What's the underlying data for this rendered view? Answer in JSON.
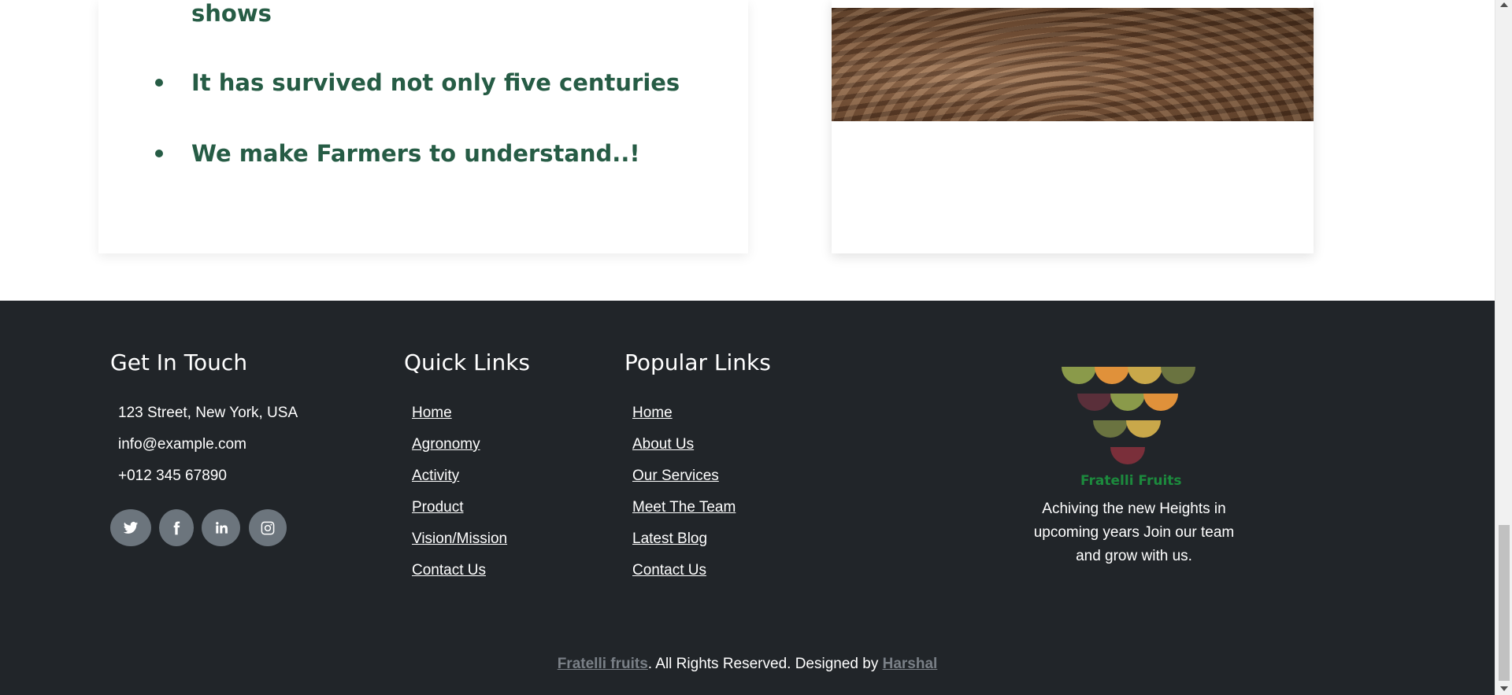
{
  "features": {
    "continued_text": "shows",
    "items": [
      "It has survived not only five centuries",
      "We make Farmers to understand..!"
    ]
  },
  "footer": {
    "get_in_touch": {
      "title": "Get In Touch",
      "address": "123 Street, New York, USA",
      "email": "info@example.com",
      "phone": "+012 345 67890",
      "social": [
        "twitter-icon",
        "facebook-icon",
        "linkedin-icon",
        "instagram-icon"
      ]
    },
    "quick_links": {
      "title": "Quick Links",
      "items": [
        "Home",
        "Agronomy",
        "Activity",
        "Product",
        "Vision/Mission",
        "Contact Us"
      ]
    },
    "popular_links": {
      "title": "Popular Links",
      "items": [
        "Home",
        "About Us",
        "Our Services",
        "Meet The Team",
        "Latest Blog",
        "Contact Us"
      ]
    },
    "brand": {
      "logo_text": "Fratelli Fruits",
      "tagline": "Achiving the new Heights in upcoming years Join our team and grow with us."
    },
    "copyright": {
      "brand_link": "Fratelli fruits",
      "text": ". All Rights Reserved. Designed by ",
      "designer_link": "Harshal"
    }
  },
  "colors": {
    "heading_green": "#265c45",
    "footer_bg": "#212529",
    "social_bg": "#6c757d",
    "logo_green": "#1c8a3d"
  }
}
